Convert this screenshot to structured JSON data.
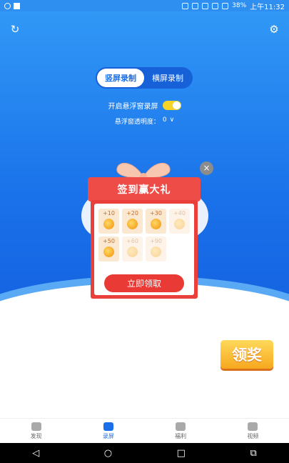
{
  "status_bar": {
    "battery": "38%",
    "time": "上午11:32"
  },
  "orientation": {
    "portrait": "竖屏录制",
    "landscape": "横屏录制",
    "active": "portrait"
  },
  "float_window": {
    "label": "开启悬浮窗录屏",
    "enabled": true
  },
  "opacity": {
    "label": "悬浮窗透明度：",
    "value": "0"
  },
  "modal": {
    "title": "签到赢大礼",
    "days": [
      {
        "amount": "+10",
        "claimed": false,
        "available": true
      },
      {
        "amount": "+20",
        "available": true
      },
      {
        "amount": "+30",
        "available": true
      },
      {
        "amount": "+40",
        "available": false
      },
      {
        "amount": "+50",
        "available": true
      },
      {
        "amount": "+60",
        "available": false
      },
      {
        "amount": "+90",
        "available": false
      }
    ],
    "claim_label": "立即领取",
    "close_glyph": "×"
  },
  "reward_badge": {
    "label": "领奖"
  },
  "bottom_nav": [
    {
      "label": "发现",
      "active": false
    },
    {
      "label": "录屏",
      "active": true
    },
    {
      "label": "福利",
      "active": false
    },
    {
      "label": "视频",
      "active": false
    }
  ],
  "system_nav": {
    "back": "◁",
    "home": "○",
    "recents": "□",
    "screenshot": "⧉"
  },
  "icons": {
    "refresh": "↻",
    "settings": "⚙",
    "chevron": "∨"
  }
}
